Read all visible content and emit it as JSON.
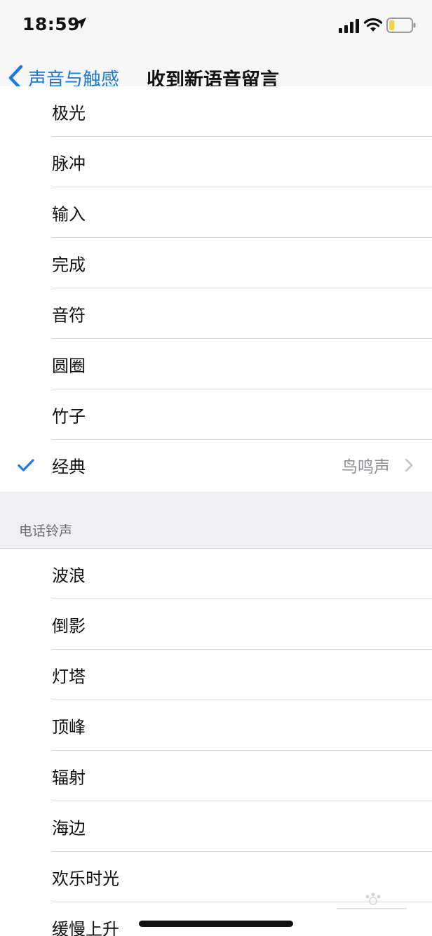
{
  "status_bar": {
    "time": "18:59",
    "icons": [
      "location-arrow-icon",
      "cellular-signal-icon",
      "wifi-icon",
      "battery-icon"
    ],
    "battery_level": 0.25,
    "battery_color": "#f5d33b"
  },
  "nav": {
    "back_label": "声音与触感",
    "title": "收到新语音留言",
    "accent_color": "#1b7ae0"
  },
  "alert_tones": {
    "items": [
      {
        "label": "极光"
      },
      {
        "label": "脉冲"
      },
      {
        "label": "输入"
      },
      {
        "label": "完成"
      },
      {
        "label": "音符"
      },
      {
        "label": "圆圈"
      },
      {
        "label": "竹子"
      },
      {
        "label": "经典",
        "selected": true,
        "detail": "鸟鸣声"
      }
    ]
  },
  "ringtones": {
    "header": "电话铃声",
    "items": [
      {
        "label": "波浪"
      },
      {
        "label": "倒影"
      },
      {
        "label": "灯塔"
      },
      {
        "label": "顶峰"
      },
      {
        "label": "辐射"
      },
      {
        "label": "海边"
      },
      {
        "label": "欢乐时光"
      },
      {
        "label": "缓慢上升"
      }
    ]
  }
}
